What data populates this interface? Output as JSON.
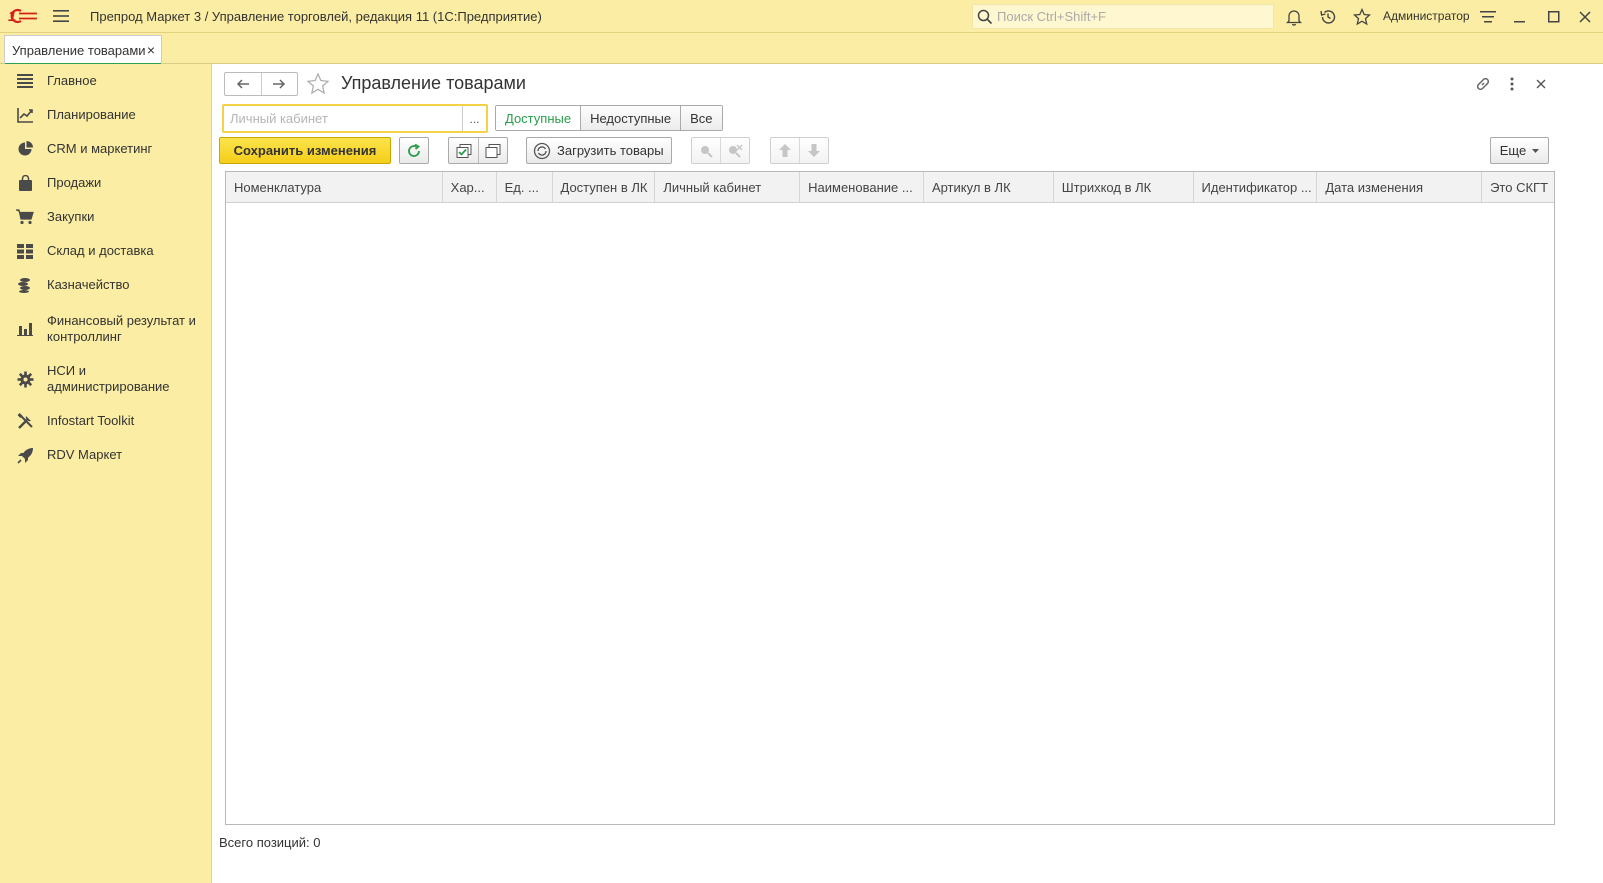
{
  "app": {
    "logo": "1С",
    "title": "Препрод Маркет 3 / Управление торговлей, редакция 11  (1С:Предприятие)",
    "search_placeholder": "Поиск Ctrl+Shift+F",
    "user": "Администратор"
  },
  "tabs": [
    {
      "label": "Управление товарами",
      "close": "×"
    }
  ],
  "sidebar": {
    "items": [
      {
        "label": "Главное",
        "icon": "list-icon"
      },
      {
        "label": "Планирование",
        "icon": "planning-icon"
      },
      {
        "label": "CRM и маркетинг",
        "icon": "pie-chart-icon"
      },
      {
        "label": "Продажи",
        "icon": "shopping-bag-icon"
      },
      {
        "label": "Закупки",
        "icon": "cart-icon"
      },
      {
        "label": "Склад и доставка",
        "icon": "warehouse-grid-icon"
      },
      {
        "label": "Казначейство",
        "icon": "coins-icon"
      },
      {
        "label": "Финансовый результат и контроллинг",
        "icon": "bar-chart-icon"
      },
      {
        "label": "НСИ и администрирование",
        "icon": "gear-icon"
      },
      {
        "label": "Infostart Toolkit",
        "icon": "tools-icon"
      },
      {
        "label": "RDV Маркет",
        "icon": "rocket-icon"
      }
    ]
  },
  "form": {
    "title": "Управление товарами",
    "lk_placeholder": "Личный кабинет",
    "lk_select": "...",
    "filter": {
      "options": [
        "Доступные",
        "Недоступные",
        "Все"
      ],
      "selected": "Доступные"
    },
    "toolbar": {
      "save_label": "Сохранить изменения",
      "load_label": "Загрузить товары",
      "more_label": "Еще"
    },
    "table": {
      "columns": [
        "Номенклатура",
        "Хар...",
        "Ед. ...",
        "Доступен в ЛК",
        "Личный кабинет",
        "Наименование ...",
        "Артикул в ЛК",
        "Штрихкод в ЛК",
        "Идентификатор ...",
        "Дата изменения",
        "Это СКГТ"
      ],
      "rows": []
    },
    "footer": {
      "label": "Всего позиций:",
      "count": "0"
    }
  },
  "colors": {
    "sidebar_bg": "#fbeda3",
    "primary_button": "#f5cd1a",
    "active_green": "#2a9d4b",
    "logo_red": "#d6201a"
  }
}
